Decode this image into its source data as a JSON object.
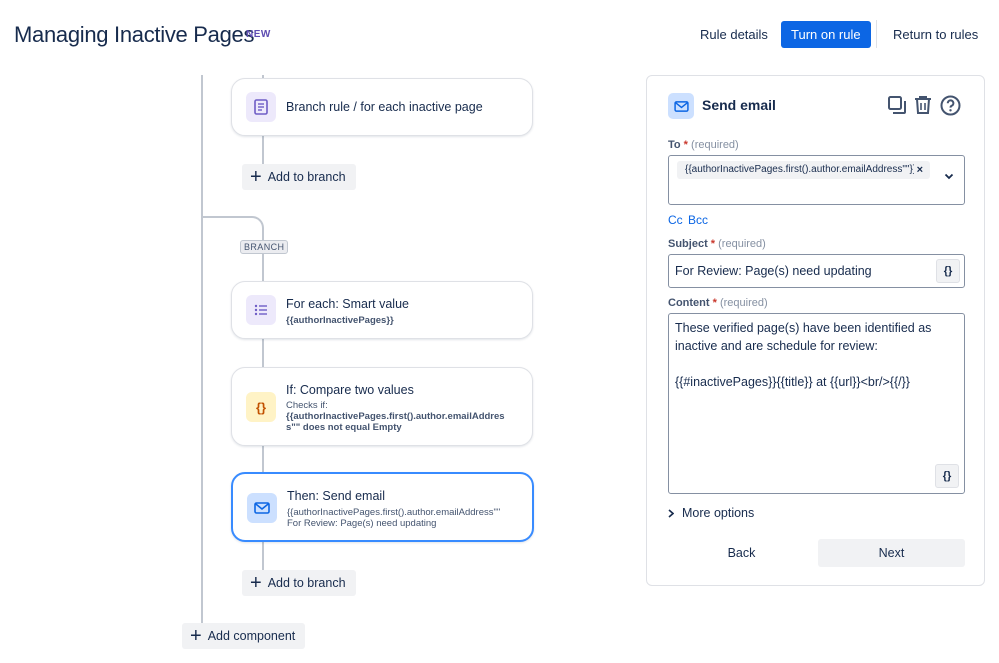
{
  "header": {
    "title": "Managing Inactive Pages",
    "badge": "NEW",
    "rule_details": "Rule details",
    "turn_on": "Turn on rule",
    "return": "Return to rules"
  },
  "canvas": {
    "branch_rule_title": "Branch rule / for each inactive page",
    "add_to_branch_1": "Add to branch",
    "branch_label": "BRANCH",
    "for_each": {
      "title": "For each: Smart value",
      "sub": "{{authorInactivePages}}"
    },
    "if_compare": {
      "title": "If: Compare two values",
      "sub1": "Checks if:",
      "sub2": "{{authorInactivePages.first().author.emailAddres",
      "sub3": "s\"\" does not equal Empty"
    },
    "send_email": {
      "title": "Then: Send email",
      "sub1": "{{authorInactivePages.first().author.emailAddress\"\"",
      "sub2": "For Review: Page(s) need updating"
    },
    "add_to_branch_2": "Add to branch",
    "add_component": "Add component"
  },
  "panel": {
    "title": "Send email",
    "to": {
      "label": "To",
      "required": "(required)",
      "chip": "{{authorInactivePages.first().author.emailAddress\"\"}}"
    },
    "cc": "Cc",
    "bcc": "Bcc",
    "subject": {
      "label": "Subject",
      "required": "(required)",
      "value": "For Review: Page(s) need updating"
    },
    "content": {
      "label": "Content",
      "required": "(required)",
      "line1": "These verified page(s) have been identified as",
      "line2": "inactive and are schedule for review:",
      "line3": "{{#inactivePages}}{{title}} at {{url}}<br/>{{/}}"
    },
    "smart_value_btn": "{}",
    "more_options": "More options",
    "back": "Back",
    "next": "Next"
  },
  "colors": {
    "primary": "#0c66e4",
    "selected_border": "#388bff",
    "icon_purple": "#6e5dc6",
    "icon_orange": "#c25100"
  }
}
